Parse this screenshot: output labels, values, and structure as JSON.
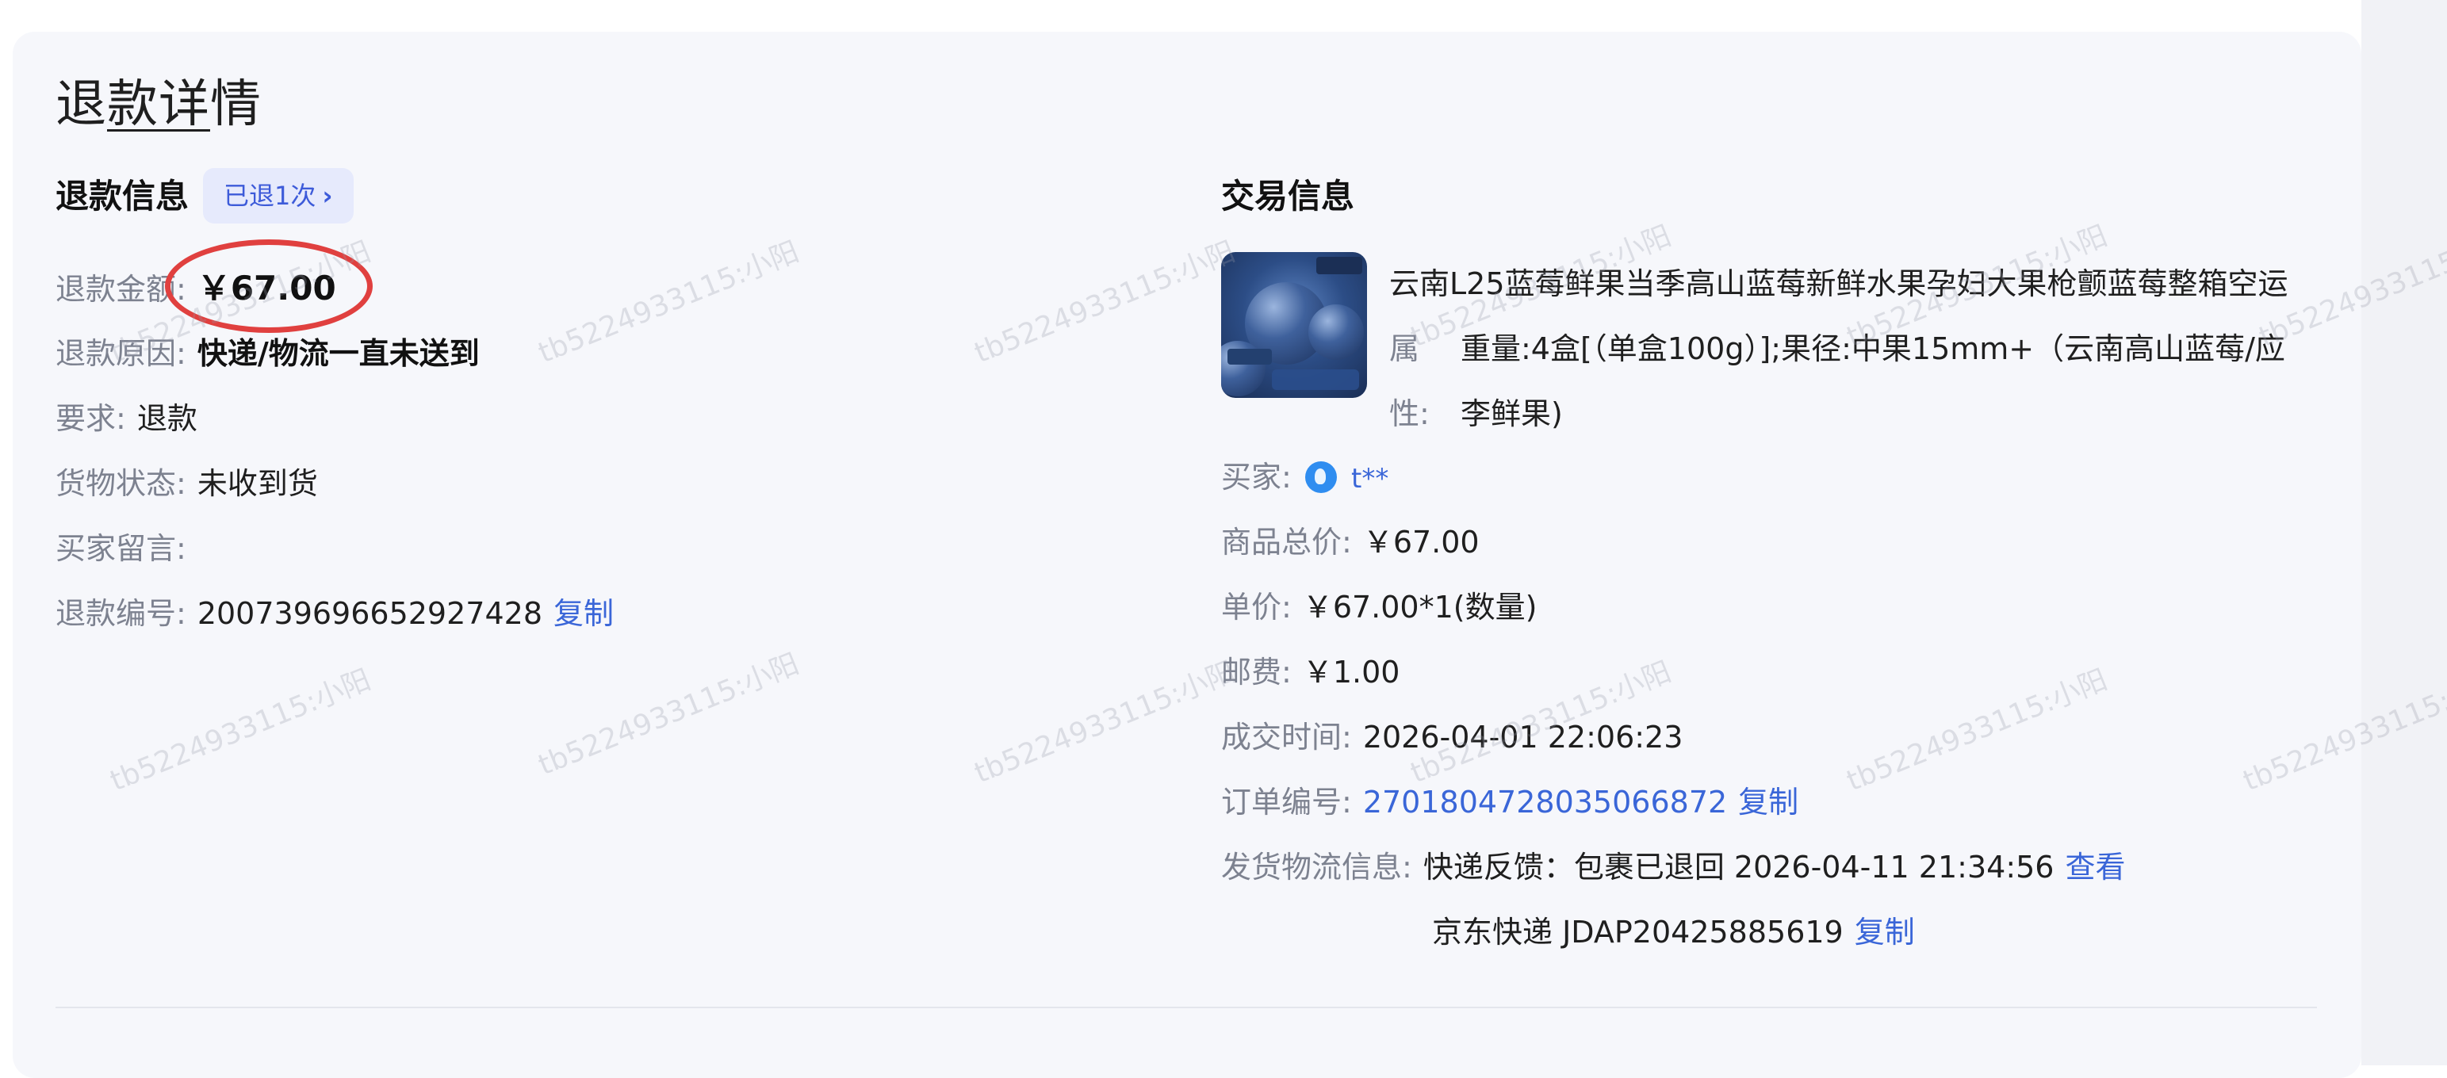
{
  "page": {
    "title_pre": "退",
    "title_ul": "款详",
    "title_post": "情"
  },
  "refund": {
    "section_title": "退款信息",
    "refund_count_badge": "已退1次",
    "amount_label": "退款金额:",
    "amount_value": "￥67.00",
    "reason_label": "退款原因:",
    "reason_value": "快递/物流一直未送到",
    "requirement_label": "要求:",
    "requirement_value": "退款",
    "goods_status_label": "货物状态:",
    "goods_status_value": "未收到货",
    "buyer_note_label": "买家留言:",
    "buyer_note_value": "",
    "refund_no_label": "退款编号:",
    "refund_no_value": "200739696652927428",
    "copy_label": "复制"
  },
  "trade": {
    "section_title": "交易信息",
    "product_title": "云南L25蓝莓鲜果当季高山蓝莓新鲜水果孕妇大果枪颤蓝莓整箱空运",
    "attr_label_1": "属",
    "attr_label_2": "性:",
    "attr_value_1": "重量:4盒[（单盒100g）];果径:中果15mm+（云南高山蓝莓/应",
    "attr_value_2": "李鲜果)",
    "buyer_label": "买家:",
    "buyer_name": "t**",
    "total_label": "商品总价:",
    "total_value": "￥67.00",
    "unit_price_label": "单价:",
    "unit_price_value": "￥67.00*1(数量)",
    "shipping_fee_label": "邮费:",
    "shipping_fee_value": "￥1.00",
    "deal_time_label": "成交时间:",
    "deal_time_value": "2026-04-01 22:06:23",
    "order_no_label": "订单编号:",
    "order_no_value": "2701804728035066872",
    "copy_label": "复制",
    "logistics_label": "发货物流信息:",
    "logistics_feedback": "快递反馈：包裹已退回 2026-04-11 21:34:56",
    "view_label": "查看",
    "courier": "京东快递 JDAP20425885619",
    "courier_copy_label": "复制"
  },
  "watermark_text": "tb5224933115:小阳",
  "colors": {
    "link": "#3a66d8",
    "circle": "#e0403f",
    "badge_bg": "#e6eafc"
  }
}
